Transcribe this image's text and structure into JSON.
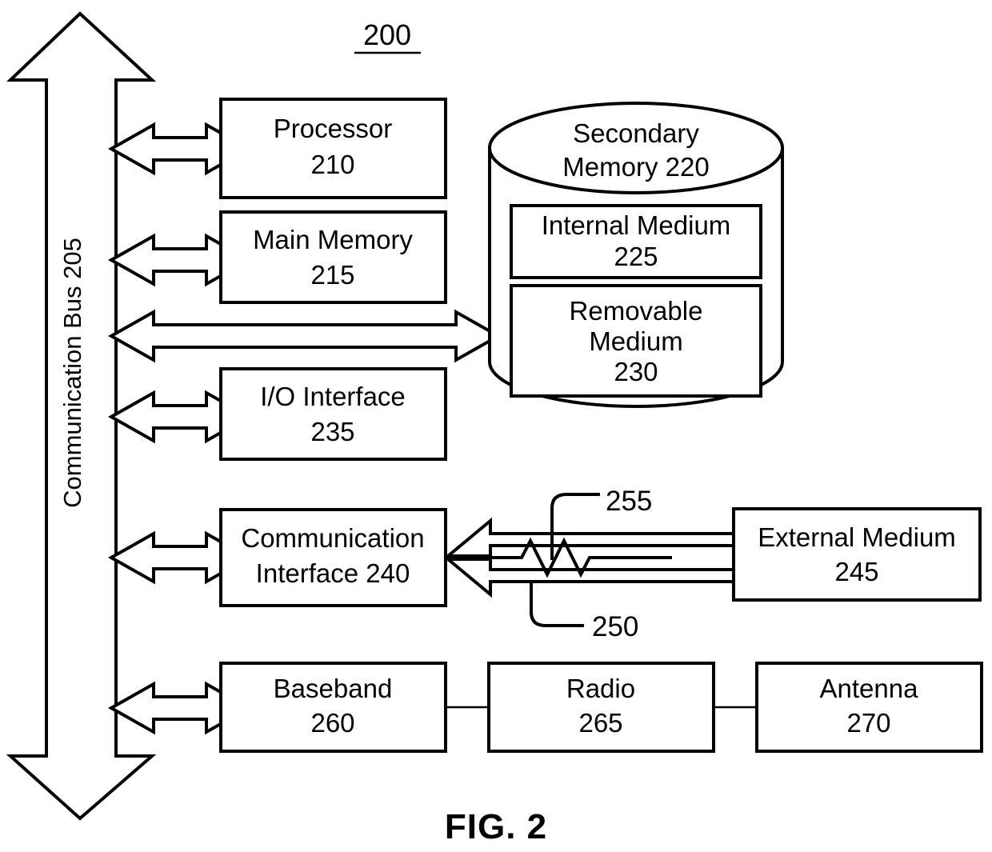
{
  "figure": {
    "title": "200",
    "caption": "FIG. 2"
  },
  "bus": {
    "label": "Communication Bus 205"
  },
  "blocks": {
    "processor": {
      "line1": "Processor",
      "line2": "210"
    },
    "main_memory": {
      "line1": "Main Memory",
      "line2": "215"
    },
    "io_interface": {
      "line1": "I/O Interface",
      "line2": "235"
    },
    "communication_interface": {
      "line1": "Communication",
      "line2": "Interface 240"
    },
    "baseband": {
      "line1": "Baseband",
      "line2": "260"
    },
    "radio": {
      "line1": "Radio",
      "line2": "265"
    },
    "antenna": {
      "line1": "Antenna",
      "line2": "270"
    },
    "external_medium": {
      "line1": "External Medium",
      "line2": "245"
    },
    "secondary_memory": {
      "line1": "Secondary",
      "line2": "Memory 220"
    },
    "internal_medium": {
      "line1": "Internal Medium",
      "line2": "225"
    },
    "removable_medium": {
      "line1": "Removable",
      "line2": "Medium",
      "line3": "230"
    }
  },
  "reference_labels": {
    "wireless_link": "255",
    "wired_link": "250"
  },
  "colors": {
    "stroke": "#000000",
    "background": "#ffffff"
  }
}
